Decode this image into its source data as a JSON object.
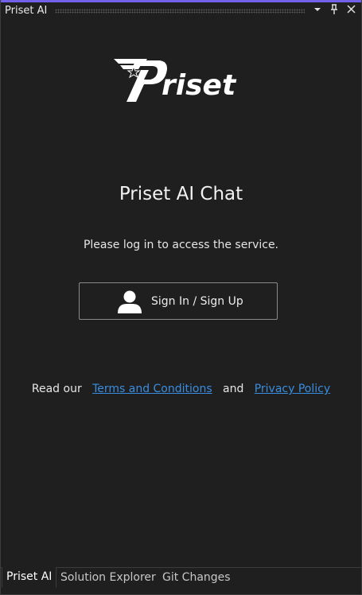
{
  "window": {
    "title": "Priset AI",
    "buttons": {
      "dropdown_icon": "chevron-down-icon",
      "pin_icon": "pin-icon",
      "close_icon": "close-icon"
    }
  },
  "main": {
    "logo_text": "Priset",
    "heading": "Priset AI Chat",
    "subtitle": "Please log in to access the service.",
    "signin": {
      "label": "Sign In / Sign Up",
      "icon": "user-icon"
    },
    "terms": {
      "prefix": "Read our",
      "terms_link": "Terms and Conditions",
      "and": "and",
      "privacy_link": "Privacy Policy"
    }
  },
  "tabs": [
    {
      "label": "Priset AI",
      "active": true
    },
    {
      "label": "Solution Explorer",
      "active": false
    },
    {
      "label": "Git Changes",
      "active": false
    }
  ],
  "colors": {
    "accent": "#7160e8",
    "background": "#1f1f1f",
    "link": "#3a8de0"
  }
}
